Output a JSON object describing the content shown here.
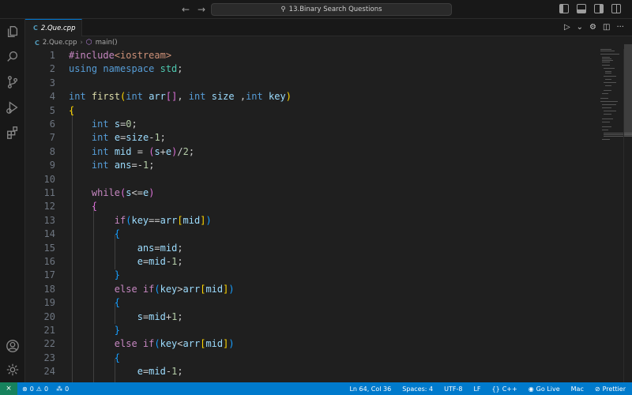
{
  "titlebar": {
    "back": "←",
    "forward": "→",
    "search_icon": "⚲",
    "search_text": "13.Binary Search Questions"
  },
  "tab": {
    "icon": "C",
    "label": "2.Que.cpp"
  },
  "breadcrumb": {
    "file": "2.Que.cpp",
    "separator": "›",
    "symbol": "main()"
  },
  "editor_actions": {
    "run": "▷",
    "run_menu": "⌄",
    "settings": "⚙",
    "split": "◫",
    "more": "···"
  },
  "code": {
    "line_numbers": [
      "1",
      "2",
      "3",
      "4",
      "5",
      "6",
      "7",
      "8",
      "9",
      "10",
      "11",
      "12",
      "13",
      "14",
      "15",
      "16",
      "17",
      "18",
      "19",
      "20",
      "21",
      "22",
      "23",
      "24"
    ]
  },
  "statusbar": {
    "remote": "⨯",
    "errors": "0",
    "warnings": "0",
    "ports": "0",
    "cursor": "Ln 64, Col 36",
    "spaces": "Spaces: 4",
    "encoding": "UTF-8",
    "eol": "LF",
    "language_icon": "{}",
    "language": "C++",
    "golive": "Go Live",
    "platform": "Mac",
    "prettier": "Prettier"
  },
  "colors": {
    "accent": "#0078d4",
    "statusbar": "#007acc",
    "remote": "#16825d",
    "keyword": "#569cd6",
    "control": "#c586c0",
    "function": "#dcdcaa",
    "variable": "#9cdcfe",
    "number": "#b5cea8"
  }
}
